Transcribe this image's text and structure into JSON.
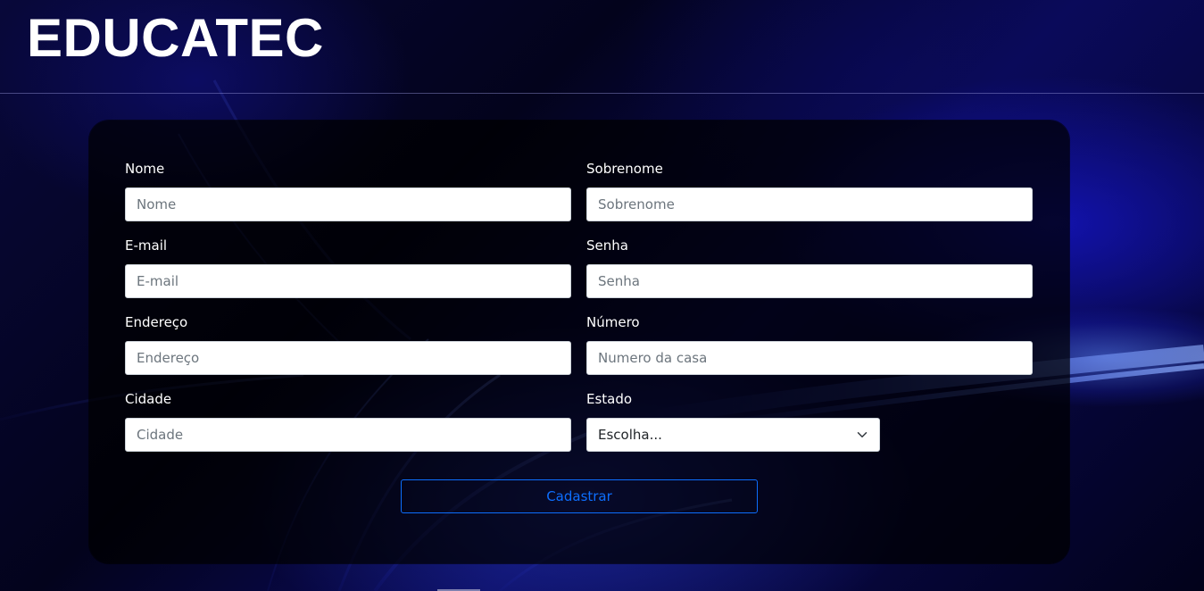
{
  "header": {
    "brand": "EDUCATEC"
  },
  "form": {
    "fields": [
      {
        "label": "Nome",
        "placeholder": "Nome"
      },
      {
        "label": "Sobrenome",
        "placeholder": "Sobrenome"
      },
      {
        "label": "E-mail",
        "placeholder": "E-mail"
      },
      {
        "label": "Senha",
        "placeholder": "Senha"
      },
      {
        "label": "Endereço",
        "placeholder": "Endereço"
      },
      {
        "label": "Número",
        "placeholder": "Numero da casa"
      },
      {
        "label": "Cidade",
        "placeholder": "Cidade"
      }
    ],
    "estado": {
      "label": "Estado",
      "selected": "Escolha..."
    },
    "submit_label": "Cadastrar"
  },
  "colors": {
    "accent": "#0d6efd",
    "background": "#02021a",
    "text": "#ffffff"
  }
}
